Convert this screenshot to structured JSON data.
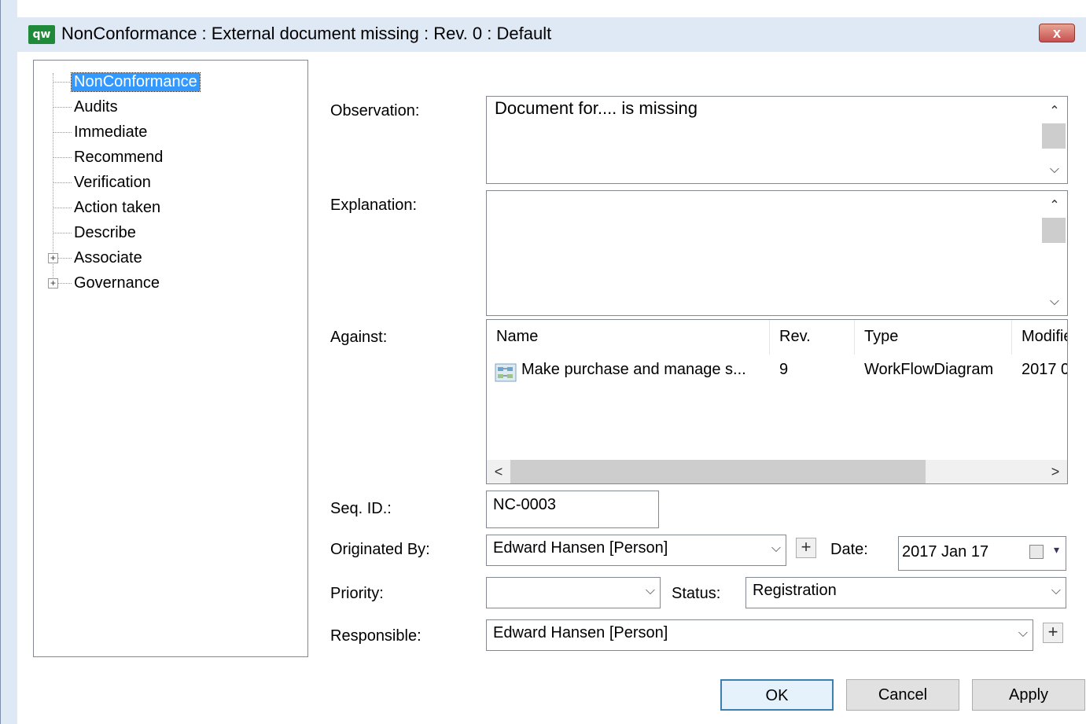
{
  "window": {
    "title": "NonConformance : External document missing : Rev. 0  : Default",
    "app_icon_text": "qw",
    "close_symbol": "x"
  },
  "tree": {
    "items": [
      {
        "label": "NonConformance",
        "selected": true,
        "expandable": false
      },
      {
        "label": "Audits",
        "selected": false,
        "expandable": false
      },
      {
        "label": "Immediate",
        "selected": false,
        "expandable": false
      },
      {
        "label": "Recommend",
        "selected": false,
        "expandable": false
      },
      {
        "label": "Verification",
        "selected": false,
        "expandable": false
      },
      {
        "label": "Action taken",
        "selected": false,
        "expandable": false
      },
      {
        "label": "Describe",
        "selected": false,
        "expandable": false
      },
      {
        "label": "Associate",
        "selected": false,
        "expandable": true
      },
      {
        "label": "Governance",
        "selected": false,
        "expandable": true
      }
    ]
  },
  "form": {
    "observation_label": "Observation:",
    "observation_value": "Document for.... is missing",
    "explanation_label": "Explanation:",
    "explanation_value": "",
    "against_label": "Against:",
    "against": {
      "columns": [
        "Name",
        "Rev.",
        "Type",
        "Modifie"
      ],
      "rows": [
        {
          "icon": "workflow-diagram-icon",
          "name": "Make purchase and manage s...",
          "rev": "9",
          "type": "WorkFlowDiagram",
          "modified": "2017 0"
        }
      ]
    },
    "seq_id_label": "Seq. ID.:",
    "seq_id_value": "NC-0003",
    "originated_by_label": "Originated By:",
    "originated_by_value": "Edward Hansen [Person]",
    "date_label": "Date:",
    "date_value": "2017 Jan  17",
    "priority_label": "Priority:",
    "priority_value": "",
    "status_label": "Status:",
    "status_value": "Registration",
    "responsible_label": "Responsible:",
    "responsible_value": "Edward Hansen [Person]"
  },
  "buttons": {
    "ok": "OK",
    "cancel": "Cancel",
    "apply": "Apply"
  },
  "icons": {
    "chevron_down": "⌵",
    "chevron_up": "⌃",
    "arrow_left": "<",
    "arrow_right": ">",
    "plus": "+",
    "dropdown_arrow": "▾"
  },
  "colors": {
    "titlebar": "#dfe9f5",
    "selection": "#3399ff",
    "close": "#c75050"
  }
}
